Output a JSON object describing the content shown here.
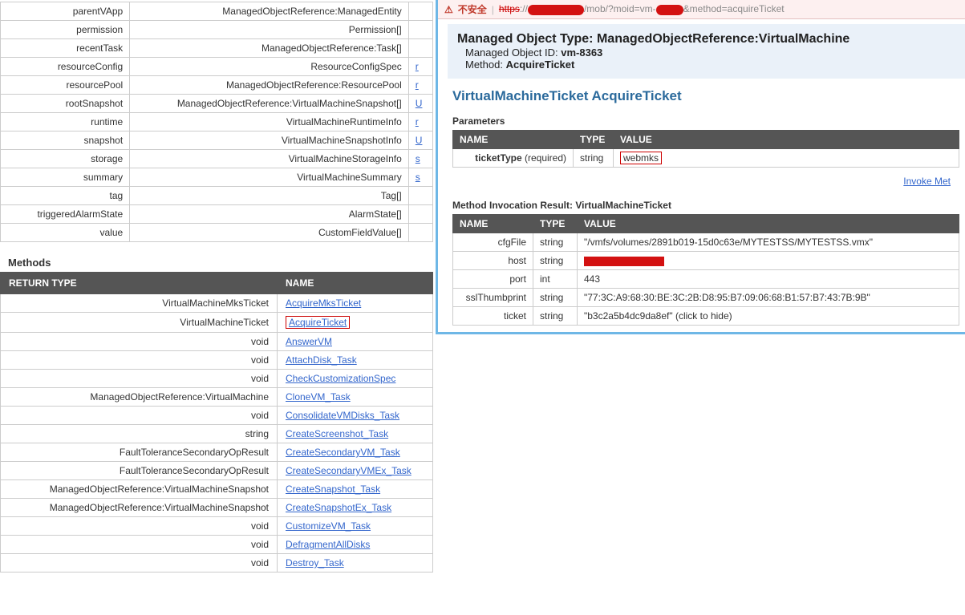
{
  "properties": [
    {
      "name": "parentVApp",
      "type": "ManagedObjectReference:ManagedEntity",
      "val": ""
    },
    {
      "name": "permission",
      "type": "Permission[]",
      "val": ""
    },
    {
      "name": "recentTask",
      "type": "ManagedObjectReference:Task[]",
      "val": ""
    },
    {
      "name": "resourceConfig",
      "type": "ResourceConfigSpec",
      "val": "r"
    },
    {
      "name": "resourcePool",
      "type": "ManagedObjectReference:ResourcePool",
      "val": "r"
    },
    {
      "name": "rootSnapshot",
      "type": "ManagedObjectReference:VirtualMachineSnapshot[]",
      "val": "U"
    },
    {
      "name": "runtime",
      "type": "VirtualMachineRuntimeInfo",
      "val": "r"
    },
    {
      "name": "snapshot",
      "type": "VirtualMachineSnapshotInfo",
      "val": "U"
    },
    {
      "name": "storage",
      "type": "VirtualMachineStorageInfo",
      "val": "s"
    },
    {
      "name": "summary",
      "type": "VirtualMachineSummary",
      "val": "s"
    },
    {
      "name": "tag",
      "type": "Tag[]",
      "val": ""
    },
    {
      "name": "triggeredAlarmState",
      "type": "AlarmState[]",
      "val": ""
    },
    {
      "name": "value",
      "type": "CustomFieldValue[]",
      "val": ""
    }
  ],
  "methods_label": "Methods",
  "methods_header": {
    "return": "RETURN TYPE",
    "name": "NAME"
  },
  "methods": [
    {
      "ret": "VirtualMachineMksTicket",
      "name": "AcquireMksTicket",
      "hot": false
    },
    {
      "ret": "VirtualMachineTicket",
      "name": "AcquireTicket",
      "hot": true
    },
    {
      "ret": "void",
      "name": "AnswerVM"
    },
    {
      "ret": "void",
      "name": "AttachDisk_Task"
    },
    {
      "ret": "void",
      "name": "CheckCustomizationSpec"
    },
    {
      "ret": "ManagedObjectReference:VirtualMachine",
      "name": "CloneVM_Task"
    },
    {
      "ret": "void",
      "name": "ConsolidateVMDisks_Task"
    },
    {
      "ret": "string",
      "name": "CreateScreenshot_Task"
    },
    {
      "ret": "FaultToleranceSecondaryOpResult",
      "name": "CreateSecondaryVM_Task"
    },
    {
      "ret": "FaultToleranceSecondaryOpResult",
      "name": "CreateSecondaryVMEx_Task"
    },
    {
      "ret": "ManagedObjectReference:VirtualMachineSnapshot",
      "name": "CreateSnapshot_Task"
    },
    {
      "ret": "ManagedObjectReference:VirtualMachineSnapshot",
      "name": "CreateSnapshotEx_Task"
    },
    {
      "ret": "void",
      "name": "CustomizeVM_Task"
    },
    {
      "ret": "void",
      "name": "DefragmentAllDisks"
    },
    {
      "ret": "void",
      "name": "Destroy_Task"
    }
  ],
  "addr": {
    "warn": "不安全",
    "scheme": "https",
    "path": "/mob/?moid=vm-",
    "tail": "&method=acquireTicket"
  },
  "obj": {
    "type_label": "Managed Object Type:",
    "type_value": "ManagedObjectReference:VirtualMachine",
    "id_label": "Managed Object ID:",
    "id_value": "vm-8363",
    "method_label": "Method:",
    "method_value": "AcquireTicket"
  },
  "method_title": "VirtualMachineTicket AcquireTicket",
  "params_label": "Parameters",
  "params_header": {
    "name": "NAME",
    "type": "TYPE",
    "value": "VALUE"
  },
  "params": [
    {
      "name": "ticketType",
      "req": "(required)",
      "type": "string",
      "value": "webmks"
    }
  ],
  "invoke": "Invoke Met",
  "result_label": "Method Invocation Result: VirtualMachineTicket",
  "result_header": {
    "name": "NAME",
    "type": "TYPE",
    "value": "VALUE"
  },
  "results": [
    {
      "name": "cfgFile",
      "type": "string",
      "value": "\"/vmfs/volumes/2891b019-15d0c63e/MYTESTSS/MYTESTSS.vmx\""
    },
    {
      "name": "host",
      "type": "string",
      "value": "[redacted]"
    },
    {
      "name": "port",
      "type": "int",
      "value": "443"
    },
    {
      "name": "sslThumbprint",
      "type": "string",
      "value": "\"77:3C:A9:68:30:BE:3C:2B:D8:95:B7:09:06:68:B1:57:B7:43:7B:9B\""
    },
    {
      "name": "ticket",
      "type": "string",
      "value": "\"b3c2a5b4dc9da8ef\" (click to hide)"
    }
  ]
}
